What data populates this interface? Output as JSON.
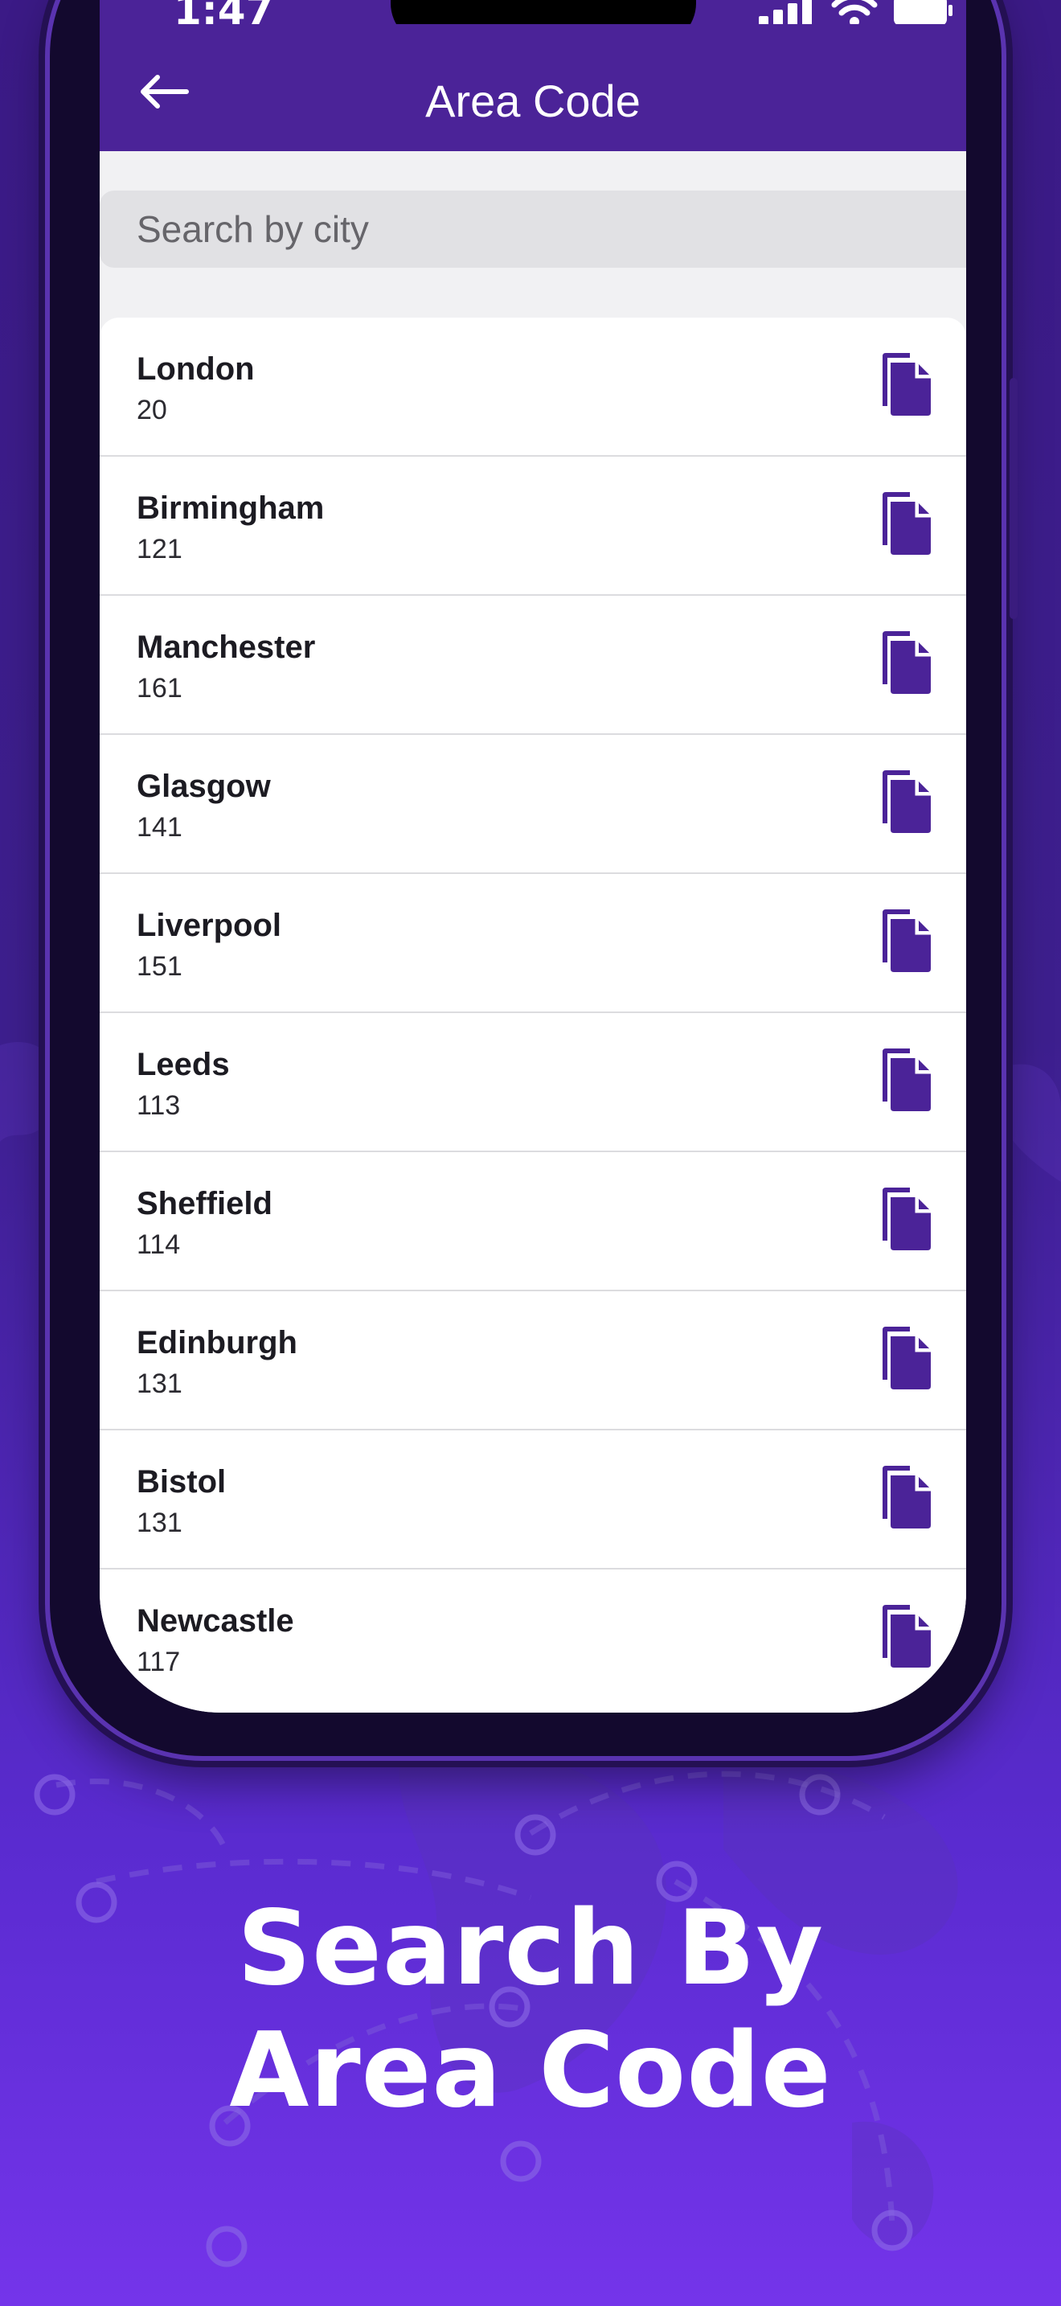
{
  "status_bar": {
    "time": "1:47",
    "icons": [
      "signal-icon",
      "wifi-icon",
      "battery-icon"
    ]
  },
  "header": {
    "back_icon": "arrow-left-icon",
    "title": "Area Code"
  },
  "search": {
    "placeholder": "Search by city",
    "value": ""
  },
  "area_codes": [
    {
      "city": "London",
      "code": "20"
    },
    {
      "city": "Birmingham",
      "code": "121"
    },
    {
      "city": "Manchester",
      "code": "161"
    },
    {
      "city": "Glasgow",
      "code": "141"
    },
    {
      "city": "Liverpool",
      "code": "151"
    },
    {
      "city": "Leeds",
      "code": "113"
    },
    {
      "city": "Sheffield",
      "code": "114"
    },
    {
      "city": "Edinburgh",
      "code": "131"
    },
    {
      "city": "Bistol",
      "code": "131"
    },
    {
      "city": "Newcastle",
      "code": "117"
    }
  ],
  "row_action_icon": "copy-icon",
  "promo": {
    "line1": "Search By",
    "line2": "Area Code"
  },
  "colors": {
    "primary": "#4b2398",
    "background_top": "#3b1a86",
    "background_bottom": "#7434ea",
    "icon": "#4b2398"
  }
}
